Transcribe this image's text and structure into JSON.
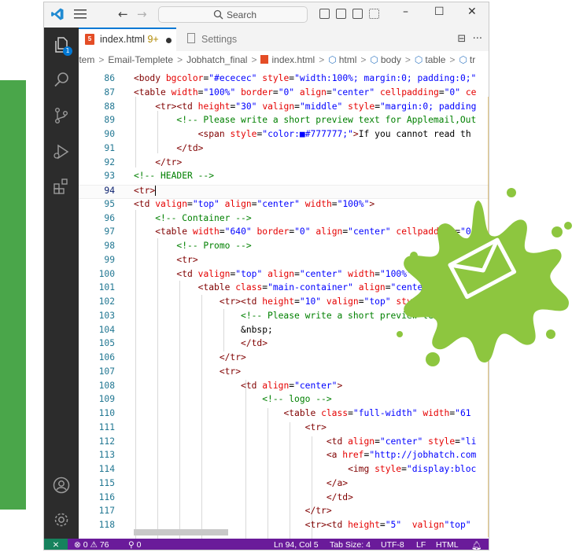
{
  "titlebar": {
    "search_placeholder": "Search",
    "back_icon": "arrow-left-icon",
    "forward_icon": "arrow-right-icon",
    "minimize": "–",
    "maximize": "☐",
    "close": "✕"
  },
  "activity_bar": {
    "explorer_badge": "1",
    "icons": [
      "explorer-icon",
      "search-icon",
      "source-control-icon",
      "run-debug-icon",
      "extensions-icon",
      "account-icon",
      "manage-gear-icon"
    ]
  },
  "tabs": [
    {
      "label": "index.html",
      "modified": "9+",
      "active": true
    },
    {
      "label": "Settings",
      "active": false
    }
  ],
  "breadcrumb": [
    "Item",
    "Email-Templete",
    "Jobhatch_final",
    "index.html",
    "html",
    "body",
    "table",
    "tr"
  ],
  "editor": {
    "lines": [
      {
        "n": "86",
        "code": "<body bgcolor=\"#ececec\" style=\"width:100%; margin:0; padding:0;\""
      },
      {
        "n": "87",
        "code": "<table width=\"100%\" border=\"0\" align=\"center\" cellpadding=\"0\" ce"
      },
      {
        "n": "88",
        "code": "    <tr><td height=\"30\" valign=\"middle\" style=\"margin:0; padding"
      },
      {
        "n": "89",
        "code": "        <!-- Please write a short preview text for Applemail,Out"
      },
      {
        "n": "90",
        "code": "            <span style=\"color:■#777777;\">If you cannot read th"
      },
      {
        "n": "91",
        "code": "        </td>"
      },
      {
        "n": "92",
        "code": "    </tr>"
      },
      {
        "n": "93",
        "code": "<!-- HEADER -->"
      },
      {
        "n": "94",
        "code": "<tr>"
      },
      {
        "n": "95",
        "code": "<td valign=\"top\" align=\"center\" width=\"100%\">"
      },
      {
        "n": "96",
        "code": "    <!-- Container -->"
      },
      {
        "n": "97",
        "code": "    <table width=\"640\" border=\"0\" align=\"center\" cellpadding=\"0\""
      },
      {
        "n": "98",
        "code": "        <!-- Promo -->"
      },
      {
        "n": "99",
        "code": "        <tr>"
      },
      {
        "n": "100",
        "code": "        <td valign=\"top\" align=\"center\" width=\"100%\" b"
      },
      {
        "n": "101",
        "code": "            <table class=\"main-container\" align=\"center"
      },
      {
        "n": "102",
        "code": "                <tr><td height=\"10\" valign=\"top\" sty"
      },
      {
        "n": "103",
        "code": "                    <!-- Please write a short preview text for A"
      },
      {
        "n": "104",
        "code": "                    &nbsp;"
      },
      {
        "n": "105",
        "code": "                    </td>"
      },
      {
        "n": "106",
        "code": "                </tr>"
      },
      {
        "n": "107",
        "code": "                <tr>"
      },
      {
        "n": "108",
        "code": "                    <td align=\"center\">"
      },
      {
        "n": "109",
        "code": "                        <!-- logo -->"
      },
      {
        "n": "110",
        "code": "                            <table class=\"full-width\" width=\"61"
      },
      {
        "n": "111",
        "code": "                                <tr>"
      },
      {
        "n": "112",
        "code": "                                    <td align=\"center\" style=\"li"
      },
      {
        "n": "113",
        "code": "                                    <a href=\"http://jobhatch.com"
      },
      {
        "n": "114",
        "code": "                                        <img style=\"display:bloc"
      },
      {
        "n": "115",
        "code": "                                    </a>"
      },
      {
        "n": "116",
        "code": "                                    </td>"
      },
      {
        "n": "117",
        "code": "                                </tr>"
      },
      {
        "n": "118",
        "code": "                                <tr><td height=\"5\"  valign=\"top\""
      }
    ],
    "current_line": "94"
  },
  "statusbar": {
    "remote_icon": "remote-icon",
    "errors": "0",
    "warnings": "76",
    "ports": "0",
    "position": "Ln 94, Col 5",
    "tab_size": "Tab Size: 4",
    "encoding": "UTF-8",
    "eol": "LF",
    "language": "HTML",
    "bell_icon": "bell-icon"
  },
  "colors": {
    "green_bar": "#4aa64a",
    "splash": "#8dc63f",
    "status_bar": "#6a1b9a",
    "activity_bar": "#2c2c2c"
  }
}
